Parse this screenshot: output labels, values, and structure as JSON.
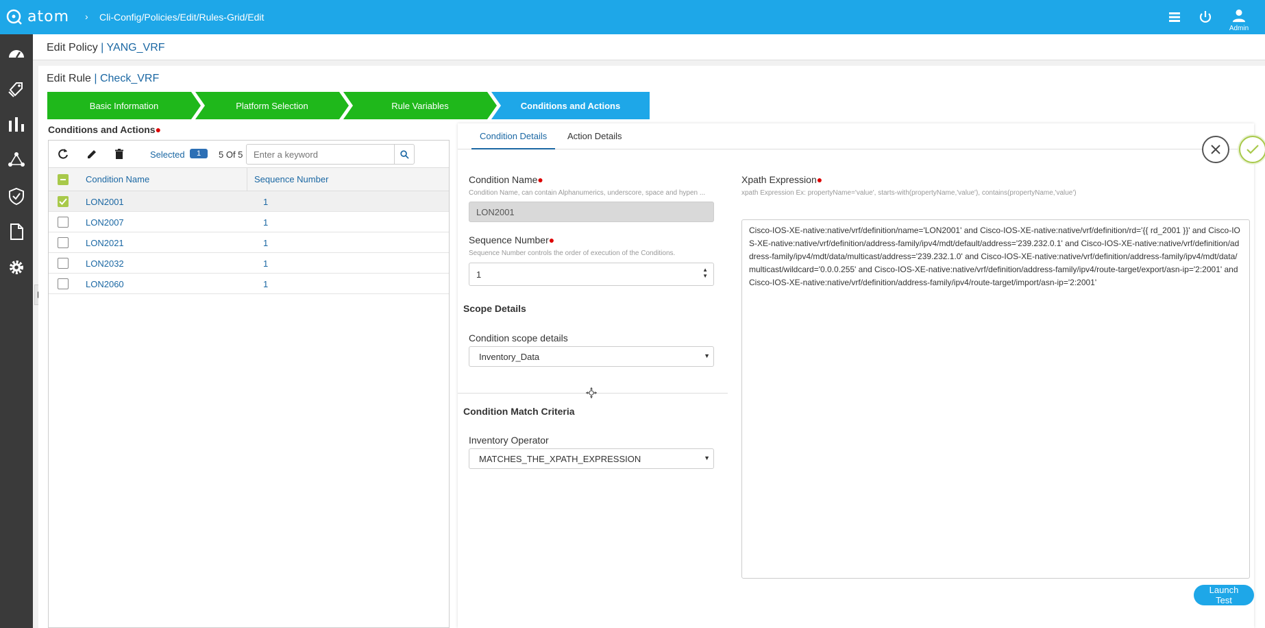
{
  "app": {
    "logo": "atom",
    "breadcrumb": "Cli-Config/Policies/Edit/Rules-Grid/Edit",
    "admin_label": "Admin"
  },
  "policy": {
    "prefix": "Edit Policy",
    "sep": " | ",
    "name": "YANG_VRF"
  },
  "rule": {
    "prefix": "Edit Rule",
    "sep": " | ",
    "name": "Check_VRF"
  },
  "steps": [
    {
      "label": "Basic Information",
      "state": "done"
    },
    {
      "label": "Platform Selection",
      "state": "done"
    },
    {
      "label": "Rule Variables",
      "state": "done"
    },
    {
      "label": "Conditions and Actions",
      "state": "active"
    }
  ],
  "conditions": {
    "section_label": "Conditions and Actions",
    "selected_label": "Selected",
    "selected_count": "1",
    "count_text": "5 Of 5",
    "search_placeholder": "Enter a keyword",
    "columns": [
      "Condition Name",
      "Sequence Number"
    ],
    "rows": [
      {
        "name": "LON2001",
        "seq": "1",
        "selected": true
      },
      {
        "name": "LON2007",
        "seq": "1",
        "selected": false
      },
      {
        "name": "LON2021",
        "seq": "1",
        "selected": false
      },
      {
        "name": "LON2032",
        "seq": "1",
        "selected": false
      },
      {
        "name": "LON2060",
        "seq": "1",
        "selected": false
      }
    ]
  },
  "details": {
    "tabs": [
      "Condition Details",
      "Action Details"
    ],
    "condition_name": {
      "label": "Condition Name",
      "help": "Condition Name, can contain Alphanumerics, underscore, space and hypen ...",
      "value": "LON2001"
    },
    "sequence_number": {
      "label": "Sequence Number",
      "help": "Sequence Number controls the order of execution of the Conditions.",
      "value": "1"
    },
    "scope": {
      "title": "Scope Details",
      "label": "Condition scope details",
      "value": "Inventory_Data"
    },
    "match": {
      "title": "Condition Match Criteria",
      "label": "Inventory Operator",
      "value": "MATCHES_THE_XPATH_EXPRESSION"
    },
    "xpath": {
      "label": "Xpath Expression",
      "help": "xpath Expression Ex: propertyName='value', starts-with(propertyName,'value'), contains(propertyName,'value')",
      "value": "Cisco-IOS-XE-native:native/vrf/definition/name='LON2001' and Cisco-IOS-XE-native:native/vrf/definition/rd='{{ rd_2001 }}' and Cisco-IOS-XE-native:native/vrf/definition/address-family/ipv4/mdt/default/address='239.232.0.1' and Cisco-IOS-XE-native:native/vrf/definition/address-family/ipv4/mdt/data/multicast/address='239.232.1.0' and Cisco-IOS-XE-native:native/vrf/definition/address-family/ipv4/mdt/data/multicast/wildcard='0.0.0.255' and Cisco-IOS-XE-native:native/vrf/definition/address-family/ipv4/route-target/export/asn-ip='2:2001' and Cisco-IOS-XE-native:native/vrf/definition/address-family/ipv4/route-target/import/asn-ip='2:2001'"
    },
    "launch_button": "Launch Test Config"
  },
  "colors": {
    "topbar": "#1ea7e8",
    "step_done": "#1fb81b",
    "step_active": "#1ea7e8",
    "sidebar": "#3a3a3a",
    "link": "#1a67a3",
    "confirm": "#a8c94a"
  }
}
